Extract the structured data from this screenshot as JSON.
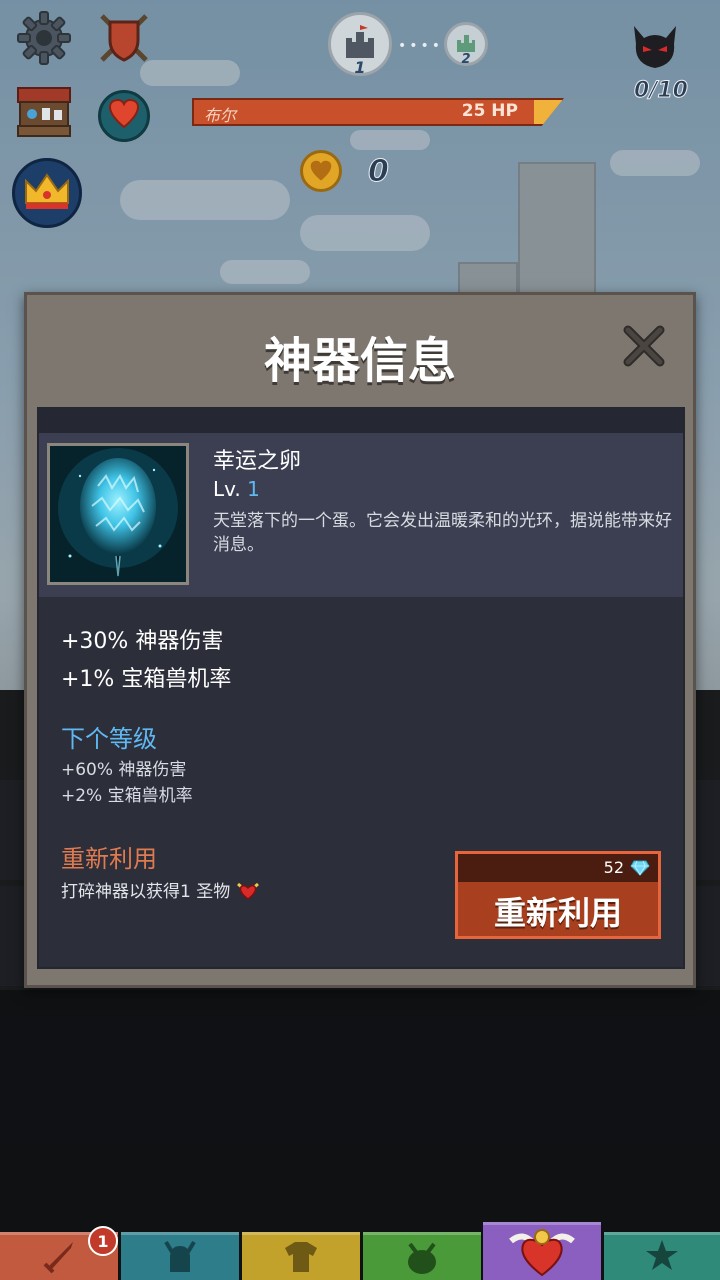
{
  "hud": {
    "stage_current": "1",
    "stage_next": "2",
    "boss_count": "0/10",
    "enemy_name": "布尔",
    "enemy_hp": "25 HP",
    "coins": "0"
  },
  "modal": {
    "title": "神器信息",
    "artifact": {
      "name": "幸运之卵",
      "level_prefix": "Lv.",
      "level": "1",
      "description": "天堂落下的一个蛋。它会发出温暖柔和的光环，据说能带来好消息。"
    },
    "stats": [
      "+30% 神器伤害",
      "+1% 宝箱兽机率"
    ],
    "next_level": {
      "title": "下个等级",
      "stats": [
        "+60% 神器伤害",
        "+2% 宝箱兽机率"
      ]
    },
    "recycle": {
      "title": "重新利用",
      "description": "打碎神器以获得1 圣物",
      "cost": "52",
      "button_label": "重新利用"
    }
  },
  "tabs": {
    "weapon_badge": "1"
  },
  "colors": {
    "accent_blue": "#5fb8f2",
    "recycle_orange": "#e07a4f",
    "button_red": "#a83f1f"
  },
  "icons": [
    "gear-icon",
    "shield-icon",
    "shop-icon",
    "heart-icon",
    "crown-icon",
    "castle-icon",
    "demon-icon",
    "coin-icon",
    "close-icon",
    "diamond-icon",
    "sword-icon",
    "helmet-icon",
    "shirt-icon",
    "pet-icon",
    "artifact-heart-icon",
    "star-icon"
  ]
}
